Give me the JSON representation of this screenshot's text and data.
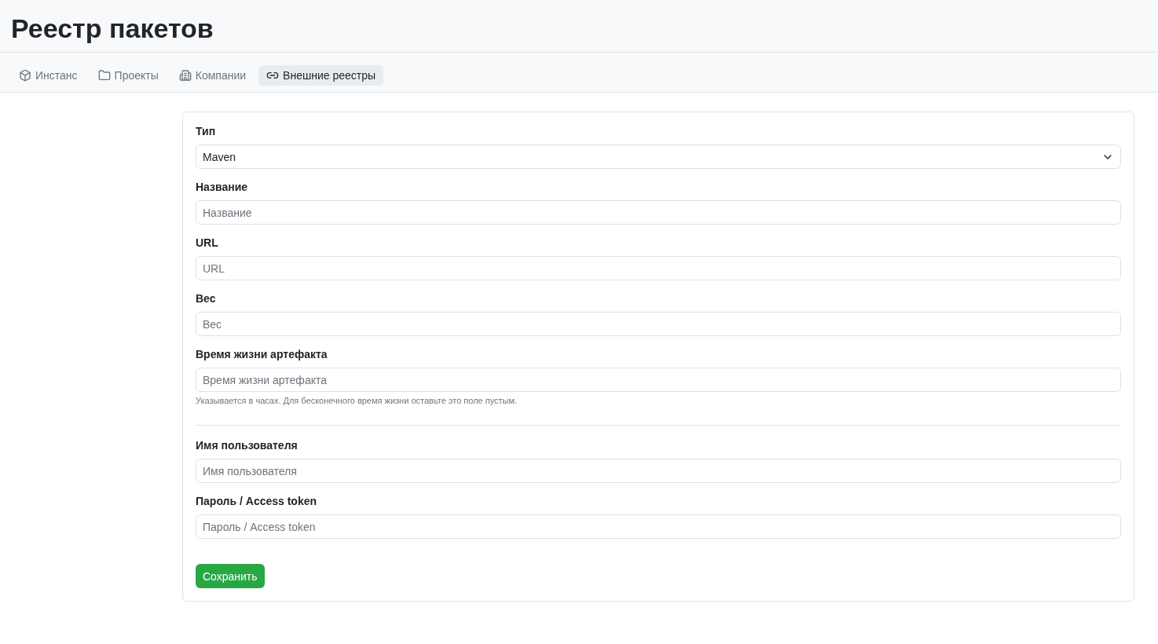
{
  "page": {
    "title": "Реестр пакетов"
  },
  "tabs": [
    {
      "label": "Инстанс",
      "selected": false
    },
    {
      "label": "Проекты",
      "selected": false
    },
    {
      "label": "Компании",
      "selected": false
    },
    {
      "label": "Внешние реестры",
      "selected": true
    }
  ],
  "form": {
    "sections": [
      {
        "fields": [
          {
            "kind": "select",
            "label": "Тип",
            "value": "Maven"
          },
          {
            "kind": "text",
            "label": "Название",
            "placeholder": "Название"
          },
          {
            "kind": "text",
            "label": "URL",
            "placeholder": "URL"
          },
          {
            "kind": "text",
            "label": "Вес",
            "placeholder": "Вес"
          },
          {
            "kind": "text",
            "label": "Время жизни артефакта",
            "placeholder": "Время жизни артефакта",
            "hint": "Указывается в часах. Для бесконечного время жизни оставьте это поле пустым."
          }
        ]
      },
      {
        "fields": [
          {
            "kind": "text",
            "label": "Имя пользователя",
            "placeholder": "Имя пользователя"
          },
          {
            "kind": "password",
            "label": "Пароль / Access token",
            "placeholder": "Пароль / Access token"
          }
        ]
      }
    ],
    "submit": "Сохранить"
  }
}
